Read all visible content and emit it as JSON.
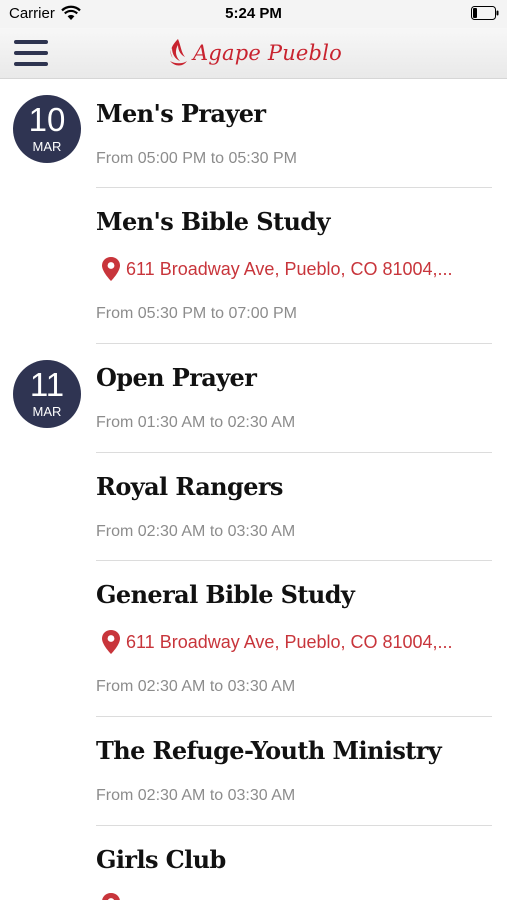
{
  "status_bar": {
    "carrier": "Carrier",
    "time": "5:24 PM"
  },
  "nav": {
    "logo_text": "Agape Pueblo"
  },
  "dates": [
    {
      "day": "10",
      "month": "MAR"
    },
    {
      "day": "11",
      "month": "MAR"
    }
  ],
  "events": [
    {
      "title": "Men's Prayer",
      "location": "",
      "time": "From 05:00 PM to 05:30 PM"
    },
    {
      "title": "Men's Bible Study",
      "location": "611 Broadway Ave, Pueblo, CO 81004,...",
      "time": "From 05:30 PM to 07:00 PM"
    },
    {
      "title": "Open Prayer",
      "location": "",
      "time": "From 01:30 AM to 02:30 AM"
    },
    {
      "title": "Royal Rangers",
      "location": "",
      "time": "From 02:30 AM to 03:30 AM"
    },
    {
      "title": "General Bible Study",
      "location": "611 Broadway Ave, Pueblo, CO 81004,...",
      "time": "From 02:30 AM to 03:30 AM"
    },
    {
      "title": "The Refuge-Youth Ministry",
      "location": "",
      "time": "From 02:30 AM to 03:30 AM"
    },
    {
      "title": "Girls Club",
      "location": "",
      "time": ""
    }
  ],
  "colors": {
    "accent": "#c8232f",
    "badge": "#2f3452",
    "muted": "#8c8c8c"
  },
  "icons": {
    "menu": "hamburger-icon",
    "location": "map-pin-icon",
    "wifi": "wifi-icon",
    "battery": "battery-icon"
  }
}
